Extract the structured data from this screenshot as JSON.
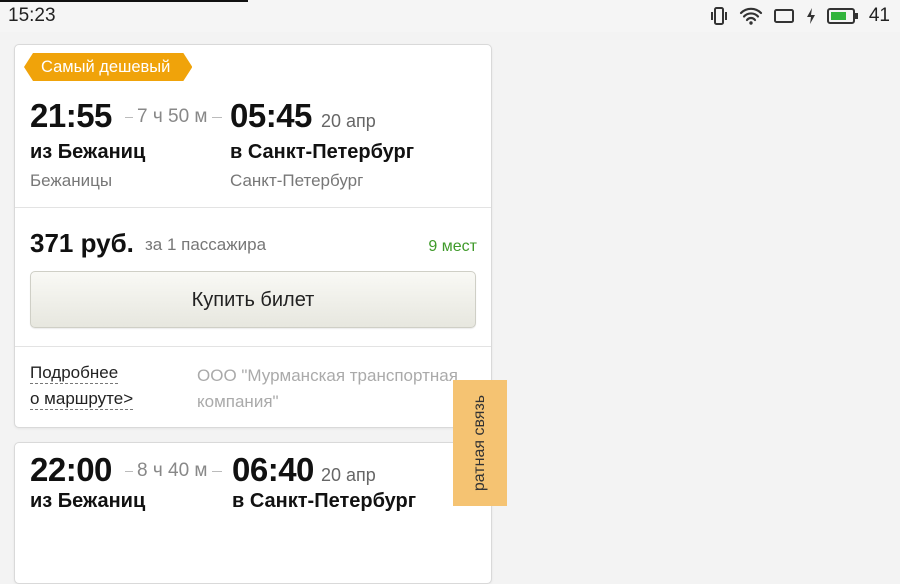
{
  "status_bar": {
    "time": "15:23",
    "battery_level": "41",
    "icons": [
      "vibrate-icon",
      "wifi-icon",
      "screen-rotation-icon",
      "charging-icon",
      "battery-icon"
    ]
  },
  "trips": [
    {
      "badge": "Самый дешевый",
      "departure_time": "21:55",
      "duration": "7 ч 50 м",
      "arrival_time": "05:45",
      "arrival_date": "20 апр",
      "from_city": "из Бежаниц",
      "from_station": "Бежаницы",
      "to_city": "в Санкт-Петербург",
      "to_station": "Санкт-Петербург",
      "price": "371 руб.",
      "per_passenger": "за 1 пассажира",
      "seats": "9 мест",
      "buy_label": "Купить билет",
      "details_line1": "Подробнее",
      "details_line2": "о маршруте>",
      "operator": "ООО \"Мурманская транспортная компания\""
    },
    {
      "departure_time": "22:00",
      "duration": "8 ч 40 м",
      "arrival_time": "06:40",
      "arrival_date": "20 апр",
      "from_city": "из Бежаниц",
      "to_city": "в Санкт-Петербург"
    }
  ],
  "feedback_label": "ратная связь",
  "colors": {
    "badge": "#f0a30a",
    "seats": "#3f9a2a",
    "feedback": "#f5c372"
  }
}
